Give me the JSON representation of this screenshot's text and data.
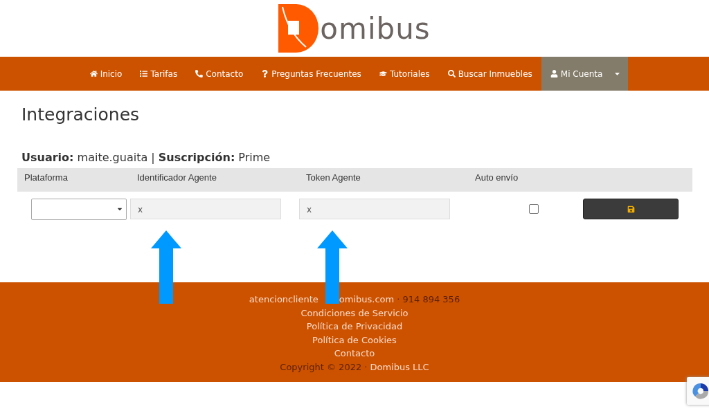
{
  "logo": {
    "text": "omibus"
  },
  "nav": [
    {
      "kind": "home",
      "label": "Inicio",
      "selected": false
    },
    {
      "kind": "list",
      "label": "Tarifas",
      "selected": false
    },
    {
      "kind": "phone",
      "label": "Contacto",
      "selected": false
    },
    {
      "kind": "question",
      "label": "Preguntas Frecuentes",
      "selected": false
    },
    {
      "kind": "cap",
      "label": "Tutoriales",
      "selected": false
    },
    {
      "kind": "search",
      "label": "Buscar Inmuebles",
      "selected": false
    },
    {
      "kind": "user",
      "label": "Mi Cuenta",
      "selected": true
    }
  ],
  "title": "Integraciones",
  "user_line": "**Usuario:** maite.guaita | **Suscripción:** Prime",
  "table": {
    "columns": [
      "Plataforma",
      "Identificador Agente",
      "Token Agente",
      "Auto envío"
    ],
    "row": {
      "identificador": "x",
      "token": "x",
      "auto_envio": false
    }
  },
  "footer": {
    "email_start": "atencioncliente",
    "email_end": "omibus.com",
    "phone": "· 914 894 356",
    "links": [
      "Condiciones de Servicio",
      "Política de Privacidad",
      "Política de Cookies",
      "Contacto"
    ],
    "copyright": "Copyright © 2022 ·",
    "company": "Domibus LLC"
  }
}
